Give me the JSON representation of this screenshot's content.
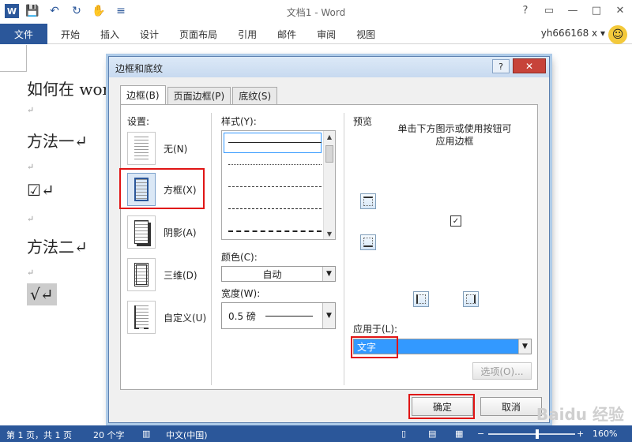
{
  "window": {
    "title": "文档1 - Word",
    "controls": [
      "?",
      "▭",
      "—",
      "□",
      "✕"
    ]
  },
  "qat": [
    "W",
    "💾",
    "↶",
    "↻",
    "✋",
    "≡"
  ],
  "ribbon": {
    "file": "文件",
    "tabs": [
      "开始",
      "插入",
      "设计",
      "页面布局",
      "引用",
      "邮件",
      "审阅",
      "视图"
    ],
    "user": "yh666168 x ▾"
  },
  "document": {
    "lines": [
      "如何在 wor",
      "↵",
      "方法一↵",
      "↵",
      "☑↵",
      "↵",
      "方法二↵",
      "↵",
      "√↵"
    ]
  },
  "dialog": {
    "title": "边框和底纹",
    "help": "?",
    "close": "✕",
    "tabs": [
      "边框(B)",
      "页面边框(P)",
      "底纹(S)"
    ],
    "settings_label": "设置:",
    "settings": [
      "无(N)",
      "方框(X)",
      "阴影(A)",
      "三维(D)",
      "自定义(U)"
    ],
    "style_label": "样式(Y):",
    "color_label": "颜色(C):",
    "color_value": "自动",
    "width_label": "宽度(W):",
    "width_value": "0.5 磅",
    "preview_label": "预览",
    "preview_hint": "单击下方图示或使用按钮可应用边框",
    "apply_label": "应用于(L):",
    "apply_value": "文字",
    "options_button": "选项(O)...",
    "ok_button": "确定",
    "cancel_button": "取消"
  },
  "status": {
    "page": "第 1 页，共 1 页",
    "words": "20 个字",
    "language": "中文(中国)",
    "zoom": "160%"
  },
  "watermark": "Baidu 经验",
  "colors": {
    "accent": "#2b579a",
    "highlight": "#e01515",
    "select": "#3399ff"
  }
}
